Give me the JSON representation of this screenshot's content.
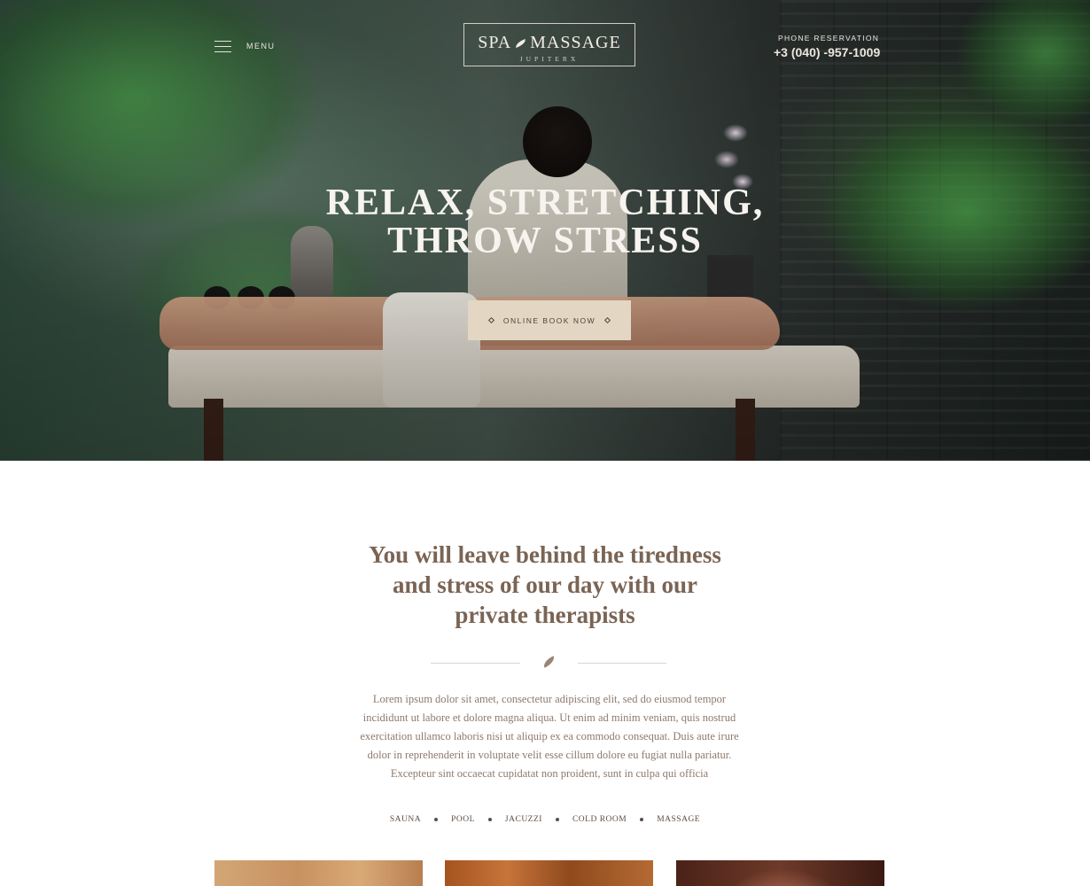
{
  "header": {
    "menu_label": "MENU",
    "logo": {
      "left_word": "SPA",
      "right_word": "MASSAGE",
      "subtitle": "JUPITERX"
    },
    "phone_label": "PHONE RESERVATION",
    "phone_number": "+3 (040) -957-1009"
  },
  "hero": {
    "title_line1": "RELAX, STRETCHING,",
    "title_line2": "THROW STRESS",
    "cta_label": "ONLINE BOOK NOW"
  },
  "intro": {
    "title_line1": "You will leave behind the tiredness",
    "title_line2": "and stress of our day with our",
    "title_line3": "private therapists",
    "body": "Lorem ipsum dolor sit amet, consectetur adipiscing elit, sed do eiusmod tempor incididunt ut labore et dolore magna aliqua. Ut enim ad minim veniam, quis nostrud exercitation ullamco laboris nisi ut aliquip ex ea commodo consequat. Duis aute irure dolor in reprehenderit in voluptate velit esse cillum dolore eu fugiat nulla pariatur. Excepteur sint occaecat cupidatat non proident, sunt in culpa qui officia"
  },
  "tags": [
    "SAUNA",
    "POOL",
    "JACUZZI",
    "COLD ROOM",
    "MASSAGE"
  ],
  "colors": {
    "accent_beige": "#e3d7c3",
    "heading_brown": "#7a6454",
    "body_brown": "#8e7a6c"
  }
}
